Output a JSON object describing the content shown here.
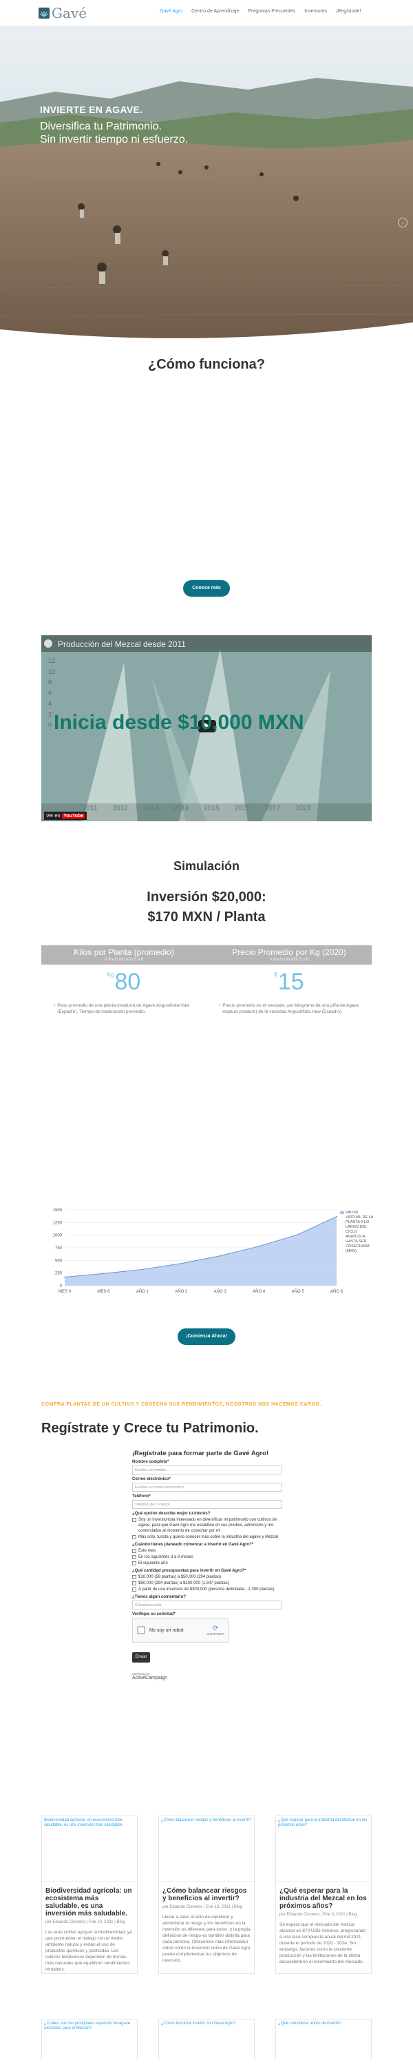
{
  "header": {
    "logo_text": "Gavé",
    "nav": [
      {
        "label": "Gavé Agro",
        "active": true
      },
      {
        "label": "Centro de Aprendizaje",
        "active": false
      },
      {
        "label": "Preguntas Frecuentes",
        "active": false
      },
      {
        "label": "Inversores",
        "active": false
      },
      {
        "label": "¡Regístrate!",
        "active": false
      }
    ]
  },
  "hero": {
    "headline": "INVIERTE EN AGAVE.",
    "sub_line1": "Diversifica tu Patrimonio.",
    "sub_line2": "Sin invertir tiempo ni esfuerzo."
  },
  "how": {
    "title": "¿Cómo funciona?",
    "button": "Conoce más"
  },
  "video": {
    "title": "Producción del Mezcal desde 2011",
    "overlay_text": "Inicia desde $10,000 MXN",
    "watch_on": "Ver en",
    "youtube": "YouTube",
    "years": [
      "2011",
      "2012",
      "2013",
      "2014",
      "2015",
      "2016",
      "2017",
      "2023"
    ],
    "yaxis": [
      "12",
      "10",
      "8",
      "6",
      "4",
      "2",
      "0"
    ]
  },
  "simulation": {
    "title": "Simulación",
    "investment_line1": "Inversión $20,000:",
    "investment_line2": "$170 MXN / Planta",
    "col1": {
      "header": "Kilos por Planta (promedio)",
      "sub": "A Partir del Año 5 a 6",
      "prefix": "Kg",
      "value": "80",
      "note": "Peso promedio de una planta (maduro) de Agave Angustifolia Haw (Espadín). Tiempo de maduración promedio."
    },
    "col2": {
      "header": "Precio Promedio por Kg (2020)",
      "sub": "A Partir del Año 5 a 6",
      "prefix": "$",
      "value": "15",
      "note": "Precio promedio en el mercado, por kilogramo de una piña de Agave madura (maduro) de la variedad Angustifolia Haw (Espadín)."
    },
    "button": "¡Comienza Ahora!"
  },
  "chart_data": {
    "type": "area",
    "categories": [
      "MES 0",
      "MES 6",
      "AÑO 1",
      "AÑO 2",
      "AÑO 3",
      "AÑO 4",
      "AÑO 5",
      "AÑO 6"
    ],
    "series": [
      {
        "name": "VALOR VIRTUAL DE LA PLANTA A LO LARGO DEL CICLO AGRÍCOLA HASTA SER COSECHADA (MXN)",
        "values": [
          170,
          240,
          320,
          440,
          590,
          780,
          1010,
          1370
        ]
      }
    ],
    "yticks": [
      "1500",
      "1250",
      "1000",
      "750",
      "500",
      "250",
      "0"
    ],
    "ylim": [
      0,
      1500
    ],
    "color": "#aec6ef"
  },
  "register": {
    "lead": "COMPRA PLANTAS DE UN CULTIVO Y COSECHA SUS RENDIMIENTOS, NOSOTROS NOS HACEMOS CARGO.",
    "title": "Regístrate y Crece tu Patrimonio."
  },
  "form": {
    "title": "¡Regístrate para formar parte de Gavé Agro!",
    "name_label": "Nombre completo*",
    "name_placeholder": "Escribe su nombre",
    "email_label": "Correo electrónico*",
    "email_placeholder": "Escriba su correo electrónico",
    "phone_label": "Teléfono*",
    "phone_placeholder": "Teléfono de contacto",
    "q1": "¿Qué opción describe mejor tu interés?",
    "q1_opts": [
      "Soy un inversionista interesado en diversificar mi patrimonio con cultivos de agave, para que Gavé Agro me estabilice en sus predios, administre y me comercialice al momento de cosechar por mí",
      "Más solo, turista y quiero conocer más sobre la industria del agave y Mezcal"
    ],
    "q2": "¿Cuándo tienes planeado comenzar a invertir en Gavé Agro?*",
    "q2_opts": [
      "Este mes",
      "En los siguientes 3 a 6 meses",
      "El siguiente año"
    ],
    "q3": "¿Qué cantidad presupuestas para invertir en Gavé Agro?*",
    "q3_opts": [
      "$10,000 (59 plantas) a $50,000 (294 plantas)",
      "$50,000 (294 plantas) a $100,000 (1,547 plantas)",
      "A partir de una inversión de $300,000 (persona delimitada - 2,300 plantas)"
    ],
    "q4": "¿Tienes algún comentario?",
    "q4_placeholder": "Cuéntanos más",
    "verify": "Verifique su solicitud*",
    "captcha": "No soy un robot",
    "captcha_brand": "reCAPTCHA",
    "submit": "Enviar",
    "powered": "Marketing by",
    "powered_brand": "ActiveCampaign"
  },
  "blog": [
    {
      "img_alt": "Biodiversidad agrícola: un ecosistema más saludable, es una inversión más saludable.",
      "title": "Biodiversidad agrícola: un ecosistema más saludable, es una inversión más saludable.",
      "meta": "por Eduardo Cisneros | Feb 10, 2021 | Blog",
      "excerpt": "Las eras cultivo apoyan la biodiversidad, ya que promueven el trabajo con el medio ambiente natural y evitan el uso de productos químicos y pesticidas. Los cultivos biodiversos dependen de formas más naturales que equilibran rendimientos rentables."
    },
    {
      "img_alt": "¿Cómo balancear riesgos y beneficios al invertir?",
      "title": "¿Cómo balancear riesgos y beneficios al invertir?",
      "meta": "por Eduardo Cisneros | Ene 13, 2021 | Blog",
      "excerpt": "Llevar a cabo el acto de equilibrar y administrar el riesgo y los beneficios en la inversión es diferente para todos, y la propia definición de riesgo es también distinta para cada persona. Ofrecemos más información sobre cómo la inversión única de Gavé Agro puede complementar tus objetivos de inversión."
    },
    {
      "img_alt": "¿Qué esperar para la industria del Mezcal en los próximos años?",
      "title": "¿Qué esperar para la industria del Mezcal en los próximos años?",
      "meta": "por Eduardo Cisneros | Ene 3, 2021 | Blog",
      "excerpt": "Se espera que el mercado del mezcal alcance en 870 USD millones, progresando a una tasa compuesta anual del mil 2021 durante el periodo de 2020 - 2024. Sin embargo, factores como la creciente producción y las limitaciones de la oferta desaceleraron el crecimiento del mercado."
    }
  ],
  "blog2": [
    "¿Cuáles son las principales especies de agave utilizadas para el Mezcal?",
    "¿Cómo funciona invertir con Gavé Agro?",
    "¿Qué considerar antes de invertir?"
  ]
}
